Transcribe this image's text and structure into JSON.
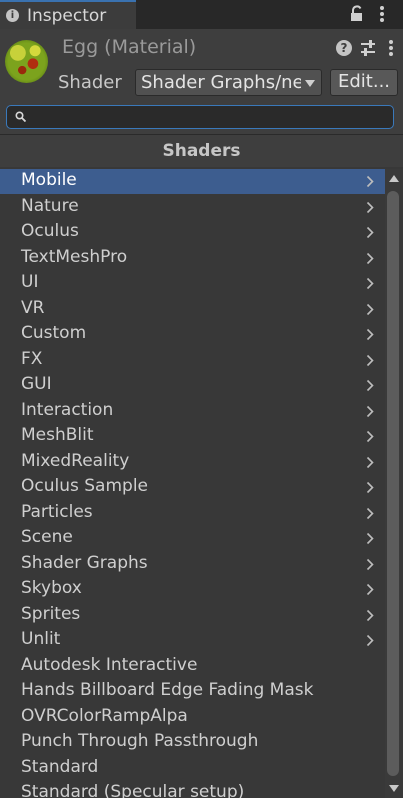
{
  "tab": {
    "title": "Inspector",
    "info_glyph": "i"
  },
  "material": {
    "name": "Egg (Material)",
    "shader_label": "Shader",
    "shader_value": "Shader Graphs/new",
    "edit_label": "Edit...",
    "help_glyph": "?"
  },
  "search": {
    "value": "",
    "placeholder": ""
  },
  "section_title": "Shaders",
  "shaders": [
    {
      "label": "Mobile",
      "has_submenu": true,
      "selected": true
    },
    {
      "label": "Nature",
      "has_submenu": true
    },
    {
      "label": "Oculus",
      "has_submenu": true
    },
    {
      "label": "TextMeshPro",
      "has_submenu": true
    },
    {
      "label": "UI",
      "has_submenu": true
    },
    {
      "label": "VR",
      "has_submenu": true
    },
    {
      "label": "Custom",
      "has_submenu": true
    },
    {
      "label": "FX",
      "has_submenu": true
    },
    {
      "label": "GUI",
      "has_submenu": true
    },
    {
      "label": "Interaction",
      "has_submenu": true
    },
    {
      "label": "MeshBlit",
      "has_submenu": true
    },
    {
      "label": "MixedReality",
      "has_submenu": true
    },
    {
      "label": "Oculus Sample",
      "has_submenu": true
    },
    {
      "label": "Particles",
      "has_submenu": true
    },
    {
      "label": "Scene",
      "has_submenu": true
    },
    {
      "label": "Shader Graphs",
      "has_submenu": true
    },
    {
      "label": "Skybox",
      "has_submenu": true
    },
    {
      "label": "Sprites",
      "has_submenu": true
    },
    {
      "label": "Unlit",
      "has_submenu": true
    },
    {
      "label": "Autodesk Interactive",
      "has_submenu": false
    },
    {
      "label": "Hands Billboard Edge Fading Mask",
      "has_submenu": false
    },
    {
      "label": "OVRColorRampAlpa",
      "has_submenu": false
    },
    {
      "label": "Punch Through Passthrough",
      "has_submenu": false
    },
    {
      "label": "Standard",
      "has_submenu": false
    },
    {
      "label": "Standard (Specular setup)",
      "has_submenu": false
    }
  ],
  "colors": {
    "selection": "#3d5d8f",
    "accent_border": "#3a79bb",
    "panel_bg": "#383838"
  },
  "icons": {
    "tab": "info-icon",
    "lock": "lock-icon",
    "menu": "kebab-menu-icon",
    "help": "help-icon",
    "presets": "sliders-icon",
    "search": "search-icon",
    "submenu": "chevron-right-icon"
  }
}
